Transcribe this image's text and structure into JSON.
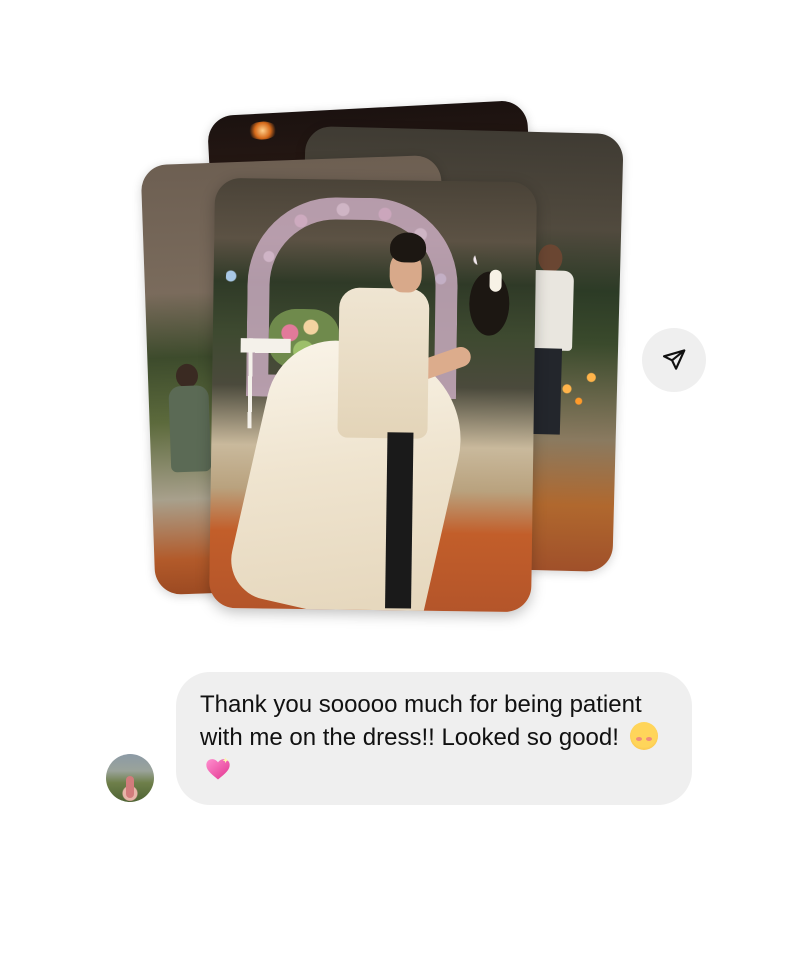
{
  "message": {
    "text": "Thank you sooooo much for being patient with me on the dress!! Looked so good!",
    "emojis": [
      "smiling-face-with-hearts",
      "sparkling-heart"
    ]
  },
  "share_button": {
    "icon": "paper-plane-icon"
  },
  "photos": {
    "count": 4,
    "subject": "wedding-photo-carousel"
  },
  "colors": {
    "bubble_bg": "#efefef",
    "bubble_text": "#111111",
    "share_bg": "#efefef",
    "page_bg": "#ffffff"
  }
}
